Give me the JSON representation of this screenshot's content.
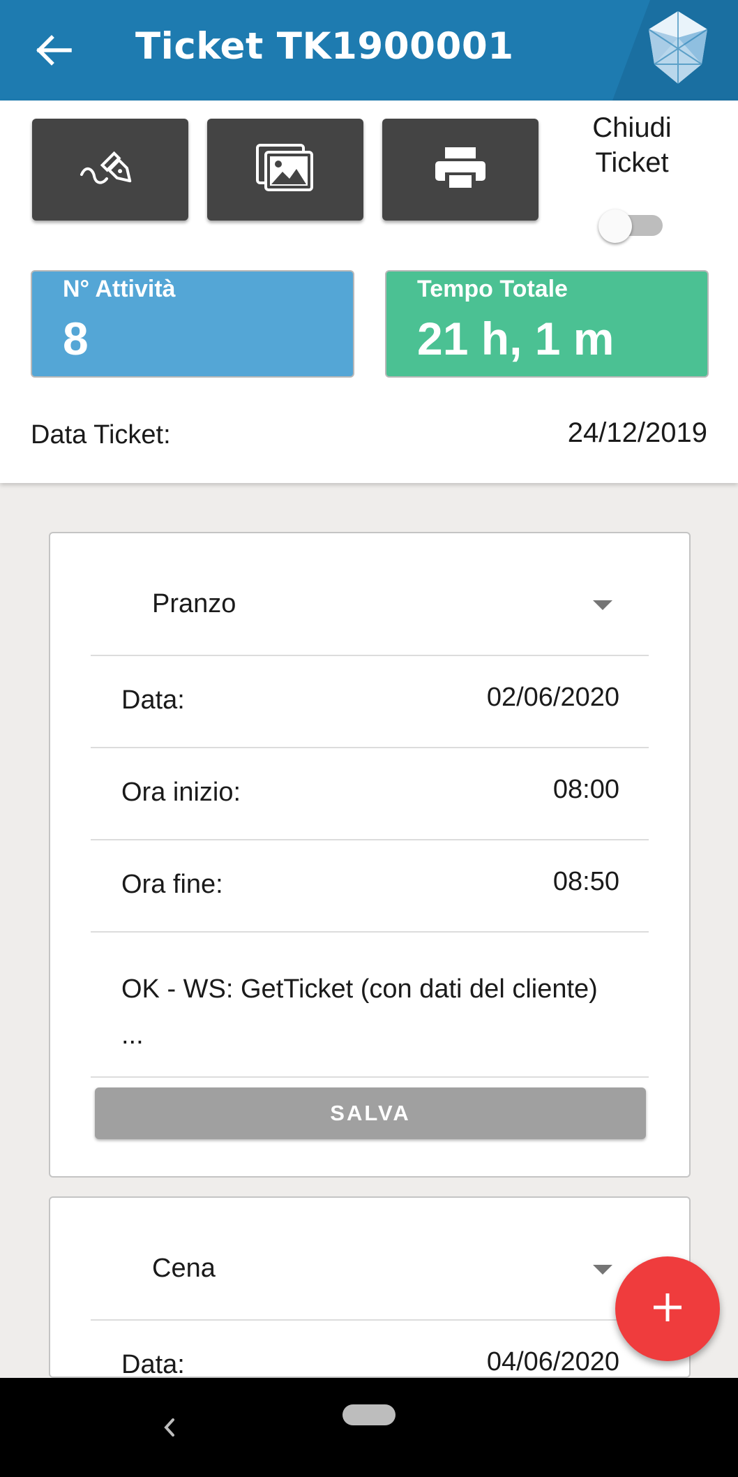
{
  "header": {
    "title": "Ticket TK1900001",
    "accent": "#1e7bb0"
  },
  "toolbar": {
    "sign_icon": "pen-nib-icon",
    "gallery_icon": "images-icon",
    "print_icon": "printer-icon",
    "close_ticket_line1": "Chiudi",
    "close_ticket_line2": "Ticket",
    "close_ticket_on": false
  },
  "stats": {
    "activities_label": "N° Attività",
    "activities_value": "8",
    "activities_color": "#54a6d6",
    "total_time_label": "Tempo Totale",
    "total_time_value": "21 h, 1 m",
    "total_time_color": "#4bc193"
  },
  "ticket": {
    "date_label": "Data Ticket:",
    "date_value": "24/12/2019"
  },
  "activities": [
    {
      "type": "Pranzo",
      "date_label": "Data:",
      "date_value": "02/06/2020",
      "start_label": "Ora inizio:",
      "start_value": "08:00",
      "end_label": "Ora fine:",
      "end_value": "08:50",
      "description": "OK - WS: GetTicket (con dati del cliente)  ...",
      "save_label": "SALVA"
    },
    {
      "type": "Cena",
      "date_label": "Data:",
      "date_value": "04/06/2020"
    }
  ],
  "fab": {
    "icon": "plus-icon",
    "color": "#ef3c3d"
  }
}
